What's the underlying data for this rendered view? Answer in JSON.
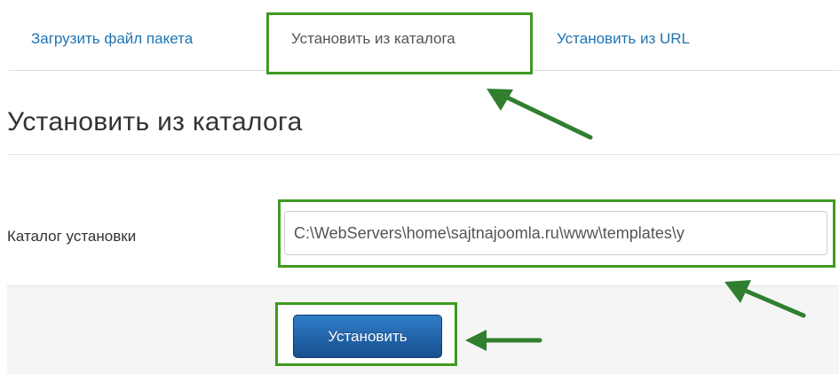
{
  "tabs": [
    {
      "label": "Загрузить файл пакета",
      "active": false
    },
    {
      "label": "Установить из каталога",
      "active": true
    },
    {
      "label": "Установить из URL",
      "active": false
    }
  ],
  "page_title": "Установить из каталога",
  "form": {
    "directory_label": "Каталог установки",
    "directory_value": "C:\\WebServers\\home\\sajtnajoomla.ru\\www\\templates\\y"
  },
  "actions": {
    "install_label": "Установить"
  },
  "colors": {
    "highlight": "#3f9a1f",
    "link": "#1f74b4",
    "button": "#1f5f9f",
    "arrow": "#2f7f2f"
  },
  "icons": {
    "annotation_arrows": "arrow-icon"
  }
}
